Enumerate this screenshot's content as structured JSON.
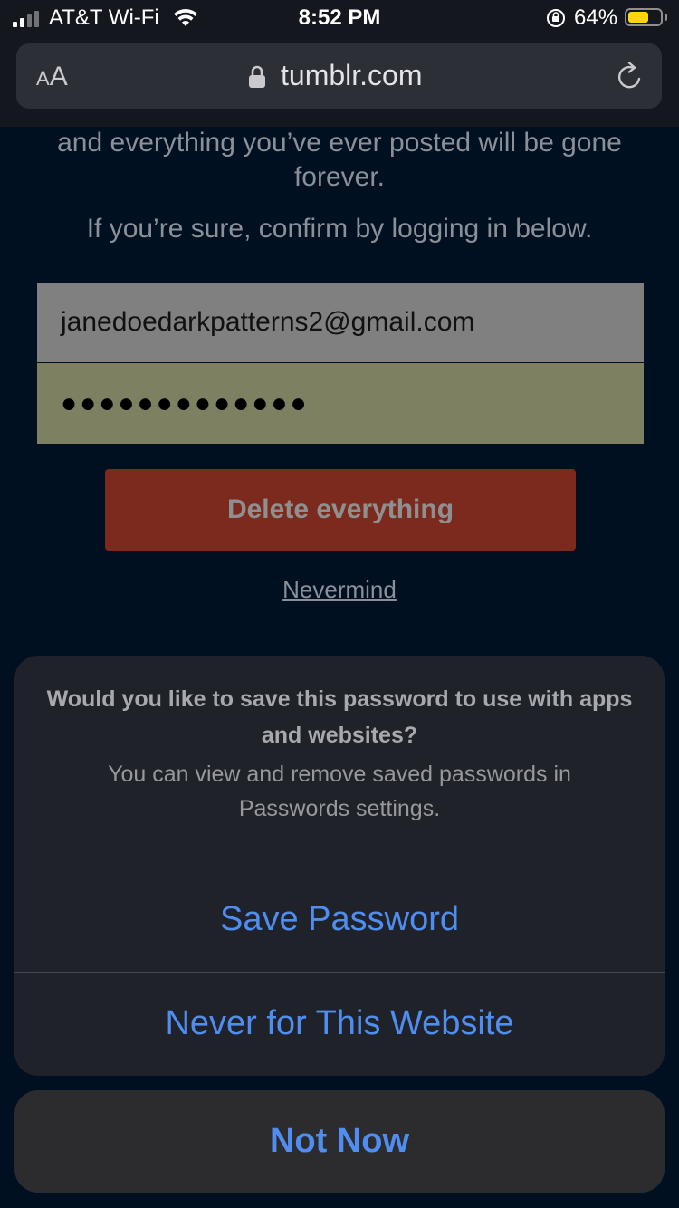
{
  "status_bar": {
    "carrier": "AT&T Wi-Fi",
    "time": "8:52 PM",
    "battery_percent": "64%",
    "battery_level": 0.64,
    "signal_bars_active": 2,
    "icons": [
      "signal-icon",
      "wifi-icon",
      "orientation-lock-icon",
      "battery-icon"
    ]
  },
  "browser": {
    "aa_label_small": "A",
    "aa_label_large": "A",
    "url": "tumblr.com",
    "icons": [
      "lock-icon",
      "reload-icon"
    ]
  },
  "page": {
    "warning_text": "and everything you’ve ever posted will be gone forever.",
    "confirm_text": "If you’re sure, confirm by logging in below.",
    "email_value": "janedoedarkpatterns2@gmail.com",
    "password_value": "●●●●●●●●●●●●●",
    "delete_button": "Delete everything",
    "nevermind_link": "Nevermind"
  },
  "save_password_sheet": {
    "title": "Would you like to save this password to use with apps and websites?",
    "message": "You can view and remove saved passwords in Passwords settings.",
    "save_button": "Save Password",
    "never_button": "Never for This Website",
    "not_now_button": "Not Now"
  },
  "colors": {
    "accent_blue": "#4f8df0",
    "delete_red": "#7c2a1e",
    "autofill_yellow": "#7d8061"
  }
}
